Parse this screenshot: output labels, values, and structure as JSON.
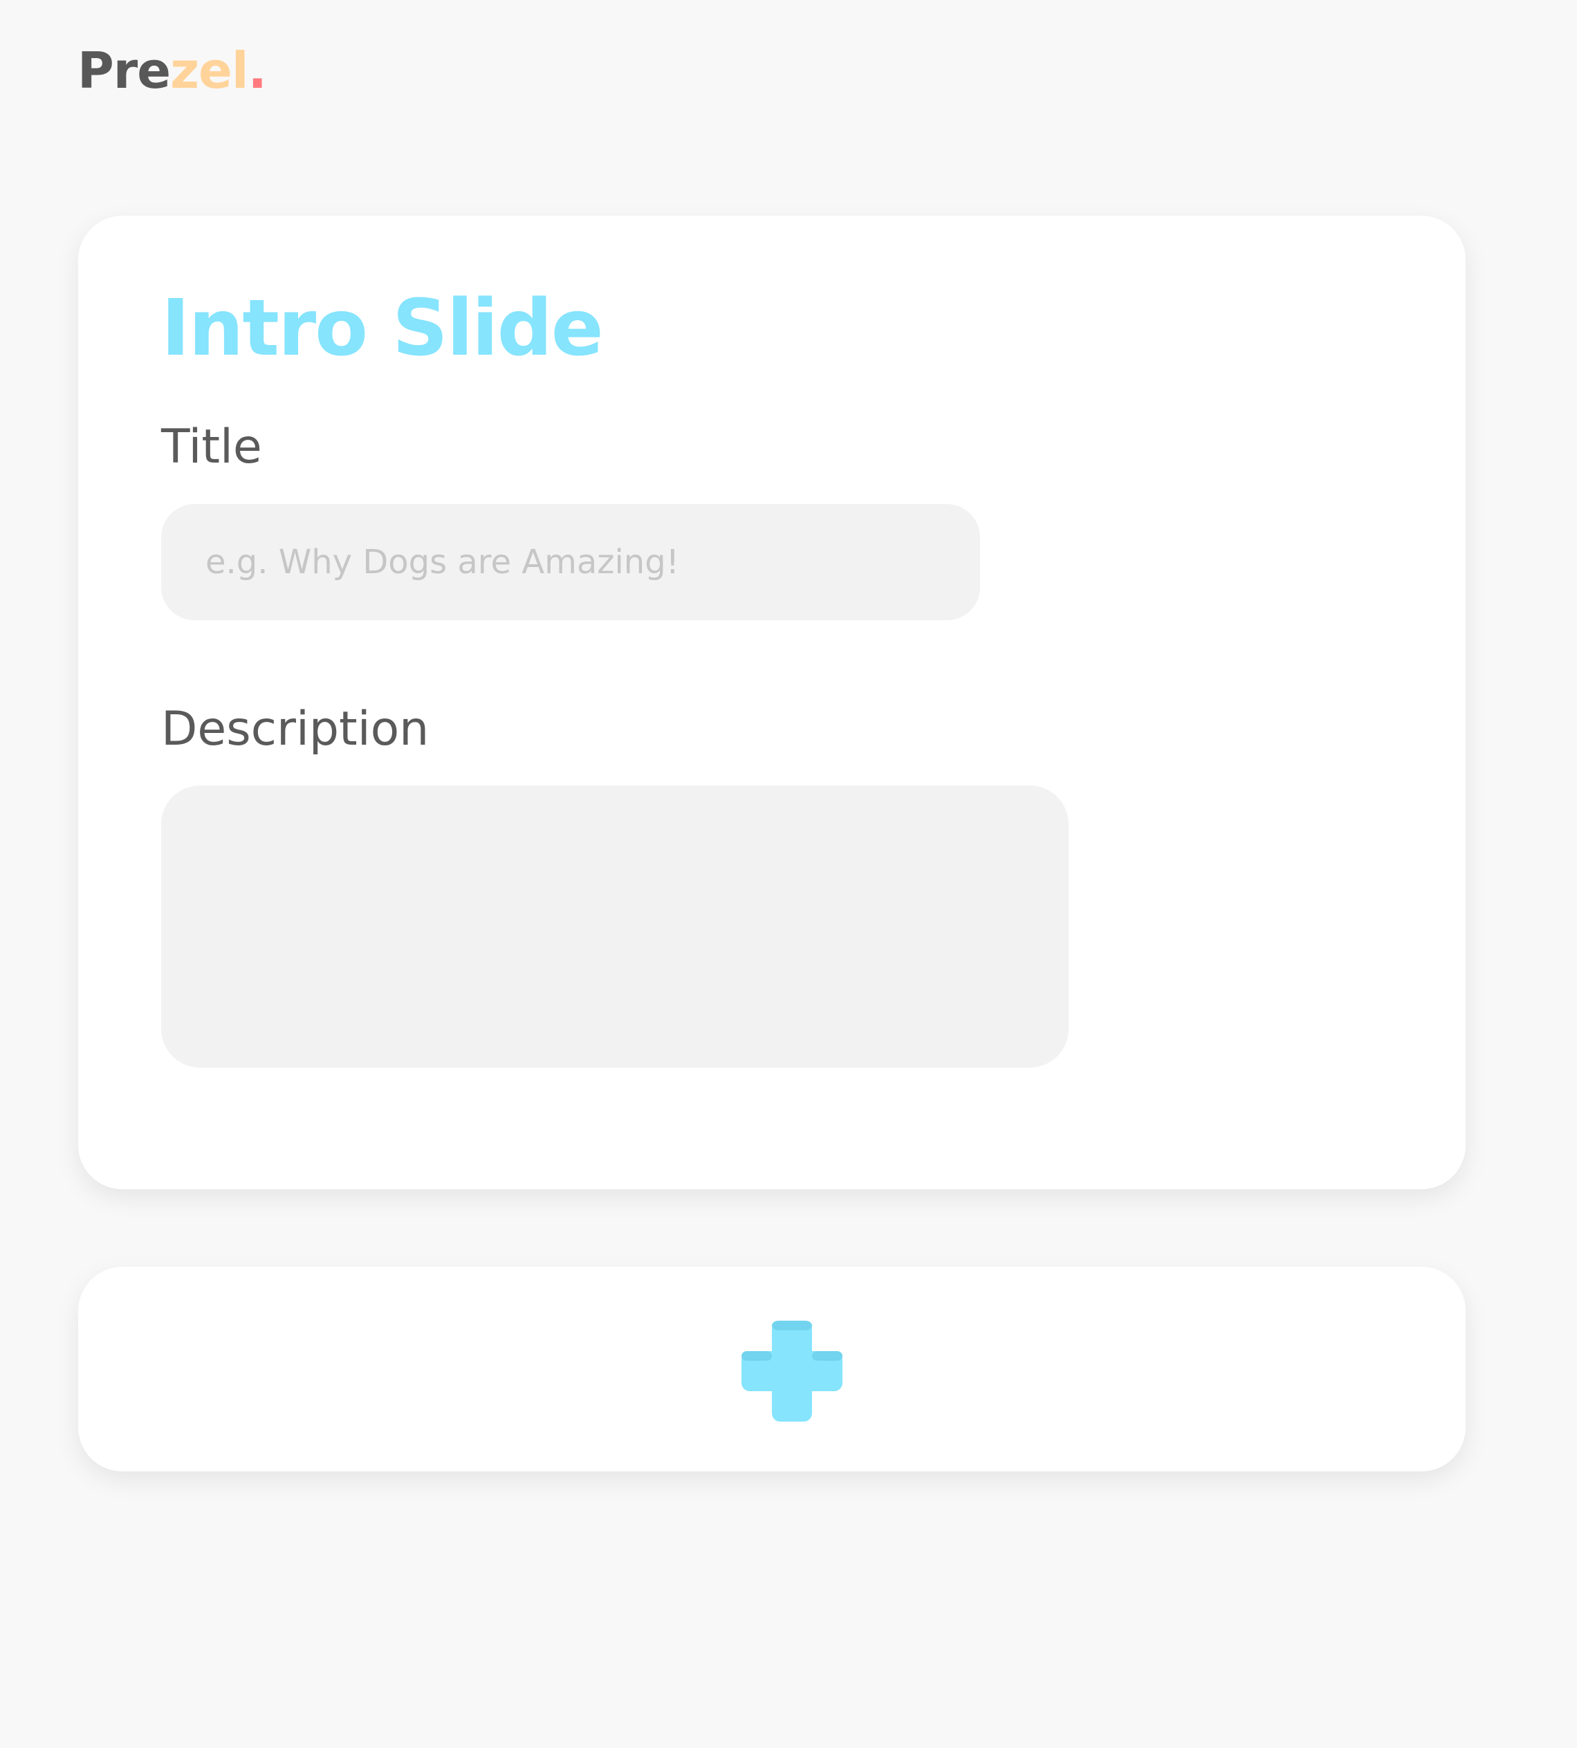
{
  "app": {
    "logo_parts": {
      "part1": "Pre",
      "part2": "zel",
      "part3": "."
    }
  },
  "slide": {
    "heading": "Intro Slide",
    "title_label": "Title",
    "title_placeholder": "e.g. Why Dogs are Amazing!",
    "title_value": "",
    "description_label": "Description",
    "description_value": ""
  },
  "add_slide": {
    "icon": "plus-icon"
  },
  "colors": {
    "background": "#f8f8f8",
    "accent": "#86e4fd",
    "logo_dark": "#585858",
    "logo_orange": "#ffd39a",
    "logo_dot": "#ff7a7f",
    "field_bg": "#f2f2f2",
    "text": "#5a5a5a",
    "placeholder": "#c6c6c6"
  }
}
